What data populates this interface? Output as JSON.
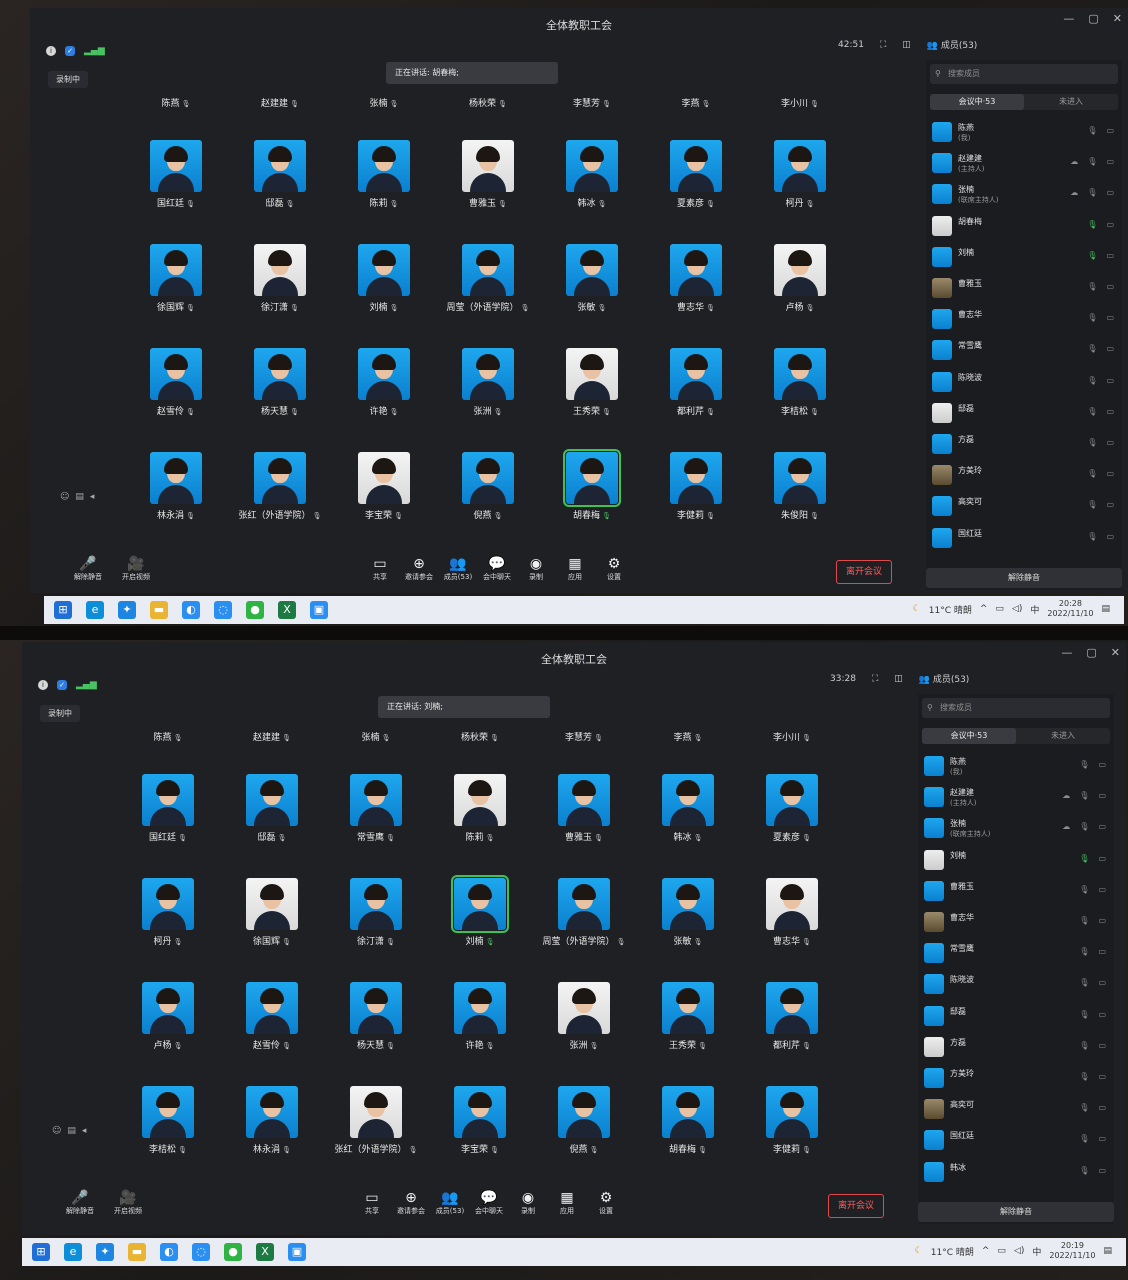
{
  "screens": [
    {
      "app_title": "全体教职工会",
      "timer": "42:51",
      "members_label": "成员(53)",
      "recording": "录制中",
      "speaking": "正在讲话: 胡春梅;",
      "grid": [
        [
          "陈燕",
          "赵建建",
          "张楠",
          "杨秋荣",
          "李慧芳",
          "李燕",
          "李小川"
        ],
        [
          "国红廷",
          "邸磊",
          "陈莉",
          "曹雅玉",
          "韩冰",
          "夏素彦",
          "柯丹"
        ],
        [
          "徐国辉",
          "徐汀潇",
          "刘楠",
          "周莹（外语学院）",
          "张敏",
          "曹志华",
          "卢杨"
        ],
        [
          "赵雪伶",
          "杨天慧",
          "许艳",
          "张洲",
          "王秀荣",
          "都利芹",
          "李桔松"
        ],
        [
          "林永涓",
          "张红（外语学院）",
          "李宝荣",
          "倪燕",
          "胡春梅",
          "李健莉",
          "朱俊阳"
        ]
      ],
      "active_cell": "胡春梅",
      "toolbar_left": [
        "解除静音",
        "开启视频"
      ],
      "toolbar": [
        "共享",
        "邀请参会",
        "成员(53)",
        "会中聊天",
        "录制",
        "应用",
        "设置"
      ],
      "leave": "离开会议",
      "search_placeholder": "搜索成员",
      "tab_in": "会议中·53",
      "tab_out": "未进入",
      "member_list": [
        {
          "name": "陈燕",
          "role": "(我)"
        },
        {
          "name": "赵建建",
          "role": "(主持人)"
        },
        {
          "name": "张楠",
          "role": "(联席主持人)"
        },
        {
          "name": "胡春梅",
          "role": ""
        },
        {
          "name": "刘楠",
          "role": ""
        },
        {
          "name": "曹雅玉",
          "role": ""
        },
        {
          "name": "曹志华",
          "role": ""
        },
        {
          "name": "常雪鹰",
          "role": ""
        },
        {
          "name": "陈晓波",
          "role": ""
        },
        {
          "name": "邸磊",
          "role": ""
        },
        {
          "name": "方磊",
          "role": ""
        },
        {
          "name": "方美玲",
          "role": ""
        },
        {
          "name": "高奕可",
          "role": ""
        },
        {
          "name": "国红廷",
          "role": ""
        }
      ],
      "unmute_all": "解除静音",
      "weather": "11°C 晴朗",
      "ime": "中",
      "time": "20:28",
      "date": "2022/11/10"
    },
    {
      "app_title": "全体教职工会",
      "timer": "33:28",
      "members_label": "成员(53)",
      "recording": "录制中",
      "speaking": "正在讲话: 刘楠;",
      "grid": [
        [
          "陈燕",
          "赵建建",
          "张楠",
          "杨秋荣",
          "李慧芳",
          "李燕",
          "李小川"
        ],
        [
          "国红廷",
          "邸磊",
          "常雪鹰",
          "陈莉",
          "曹雅玉",
          "韩冰",
          "夏素彦"
        ],
        [
          "柯丹",
          "徐国辉",
          "徐汀潇",
          "刘楠",
          "周莹（外语学院）",
          "张敏",
          "曹志华"
        ],
        [
          "卢杨",
          "赵雪伶",
          "杨天慧",
          "许艳",
          "张洲",
          "王秀荣",
          "都利芹"
        ],
        [
          "李桔松",
          "林永涓",
          "张红（外语学院）",
          "李宝荣",
          "倪燕",
          "胡春梅",
          "李健莉"
        ]
      ],
      "active_cell": "刘楠",
      "toolbar_left": [
        "解除静音",
        "开启视频"
      ],
      "toolbar": [
        "共享",
        "邀请参会",
        "成员(53)",
        "会中聊天",
        "录制",
        "应用",
        "设置"
      ],
      "leave": "离开会议",
      "search_placeholder": "搜索成员",
      "tab_in": "会议中·53",
      "tab_out": "未进入",
      "member_list": [
        {
          "name": "陈燕",
          "role": "(我)"
        },
        {
          "name": "赵建建",
          "role": "(主持人)"
        },
        {
          "name": "张楠",
          "role": "(联席主持人)"
        },
        {
          "name": "刘楠",
          "role": ""
        },
        {
          "name": "曹雅玉",
          "role": ""
        },
        {
          "name": "曹志华",
          "role": ""
        },
        {
          "name": "常雪鹰",
          "role": ""
        },
        {
          "name": "陈晓波",
          "role": ""
        },
        {
          "name": "邸磊",
          "role": ""
        },
        {
          "name": "方磊",
          "role": ""
        },
        {
          "name": "方美玲",
          "role": ""
        },
        {
          "name": "高奕可",
          "role": ""
        },
        {
          "name": "国红廷",
          "role": ""
        },
        {
          "name": "韩冰",
          "role": ""
        }
      ],
      "unmute_all": "解除静音",
      "weather": "11°C 晴朗",
      "ime": "中",
      "time": "20:19",
      "date": "2022/11/10"
    }
  ],
  "icons": {
    "info": "info-icon",
    "shield": "shield-icon",
    "signal": "signal-icon",
    "fullscreen": "fullscreen-icon",
    "layout": "layout-icon"
  },
  "colors": {
    "accent_blue": "#1ea7ee",
    "active_green": "#3cc25a",
    "leave_red": "#e14a4a"
  }
}
